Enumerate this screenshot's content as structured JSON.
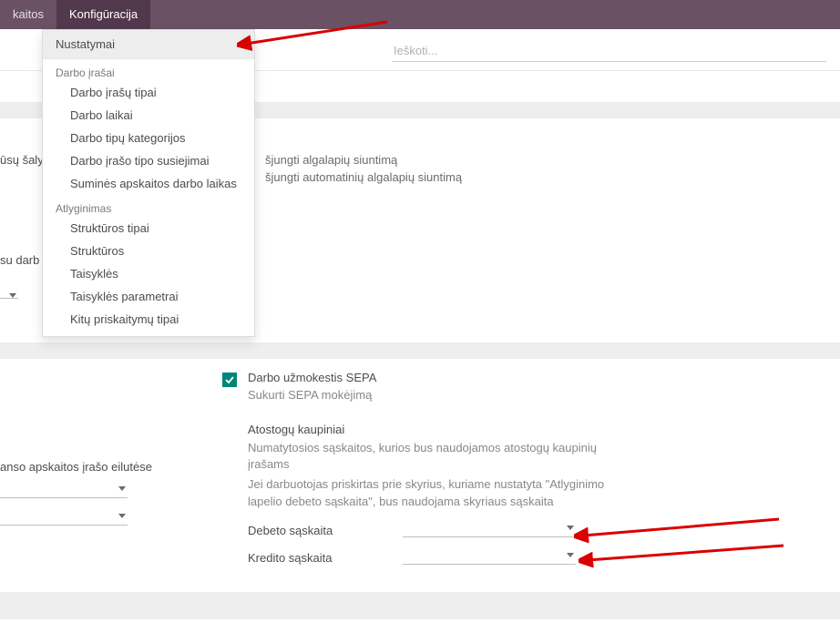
{
  "topbar": {
    "item_left": "kaitos",
    "item_active": "Konfigūracija"
  },
  "search": {
    "placeholder": "Ieškoti..."
  },
  "dropdown": {
    "top_item": "Nustatymai",
    "section1_label": "Darbo įrašai",
    "section1_items": [
      "Darbo įrašų tipai",
      "Darbo laikai",
      "Darbo tipų kategorijos",
      "Darbo įrašo tipo susiejimai",
      "Suminės apskaitos darbo laikas"
    ],
    "section2_label": "Atlyginimas",
    "section2_items": [
      "Struktūros tipai",
      "Struktūros",
      "Taisyklės",
      "Taisyklės parametrai",
      "Kitų priskaitymų tipai"
    ]
  },
  "bg_text": {
    "left_a": "ūsų šaly",
    "right_a1": "šjungti algalapių siuntimą",
    "right_a2": "šjungti automatinių algalapių siuntimą",
    "left_b": "su darb"
  },
  "left_lower": {
    "line": "anso apskaitos įrašo eilutėse"
  },
  "sepa": {
    "label": "Darbo užmokestis SEPA",
    "desc": "Sukurti SEPA mokėjimą"
  },
  "vacation": {
    "title": "Atostogų kaupiniai",
    "desc1": "Numatytosios sąskaitos, kurios bus naudojamos atostogų kaupinių įrašams",
    "desc2": "Jei darbuotojas priskirtas prie skyrius, kuriame nustatyta \"Atlyginimo lapelio debeto sąskaita\", bus naudojama skyriaus sąskaita",
    "debit_label": "Debeto sąskaita",
    "credit_label": "Kredito sąskaita"
  }
}
